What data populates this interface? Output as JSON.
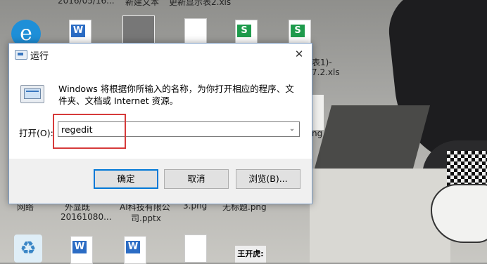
{
  "desktop": {
    "top_labels": [
      "2016/05/16...",
      "新建文本",
      "更新显示表2.xls"
    ],
    "mid_labels": [
      "表1)-",
      "7.2.xls",
      "ng"
    ],
    "bottom_labels": [
      "网络",
      "外显既",
      "AI科技有限公",
      "3.png",
      "无标题.png"
    ],
    "bottom_labels2": [
      "20161080...",
      "司.pptx"
    ],
    "doc_badges": [
      "W",
      "S",
      "S",
      "W",
      "W"
    ],
    "wps_tile": "王开虎:"
  },
  "dialog": {
    "title": "运行",
    "close_icon": "✕",
    "description": "Windows 将根据你所输入的名称，为你打开相应的程序、文件夹、文档或 Internet 资源。",
    "open_label": "打开(O):",
    "input_value": "regedit",
    "dropdown_icon": "⌄",
    "buttons": {
      "ok": "确定",
      "cancel": "取消",
      "browse": "浏览(B)..."
    }
  },
  "colors": {
    "highlight": "#d63a3a",
    "primary_border": "#0078d7"
  }
}
